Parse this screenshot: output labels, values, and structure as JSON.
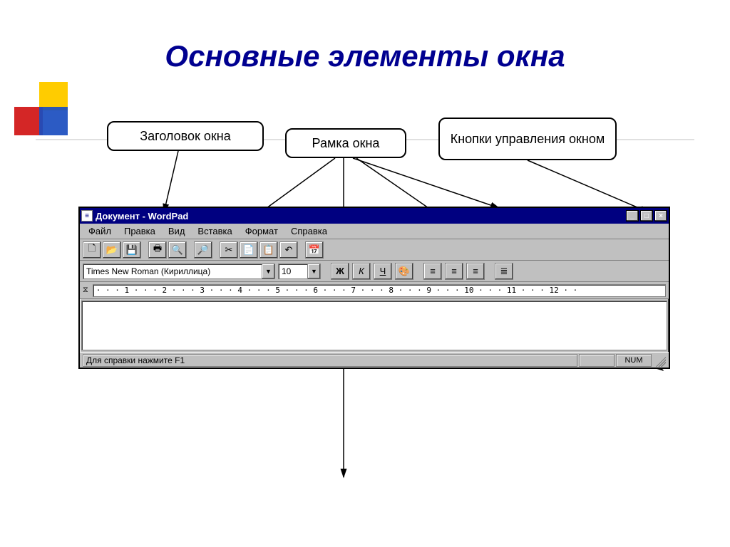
{
  "slide": {
    "title": "Основные элементы окна",
    "callouts": {
      "window_title": "Заголовок окна",
      "window_frame": "Рамка окна",
      "window_buttons": "Кнопки управления окном"
    }
  },
  "window": {
    "title": "Документ - WordPad",
    "menus": [
      "Файл",
      "Правка",
      "Вид",
      "Вставка",
      "Формат",
      "Справка"
    ],
    "font": {
      "name": "Times New Roman (Кириллица)",
      "size": "10"
    },
    "ruler_text": "· · · 1 · · · 2 · · · 3 · · · 4 · · · 5 · · · 6 · · · 7 · · · 8 · · · 9 · · · 10 · · · 11 · · · 12 · ·",
    "status": {
      "help": "Для справки нажмите F1",
      "indicator": "NUM"
    },
    "format_buttons": {
      "bold": "Ж",
      "italic": "К",
      "underline": "Ч"
    }
  }
}
